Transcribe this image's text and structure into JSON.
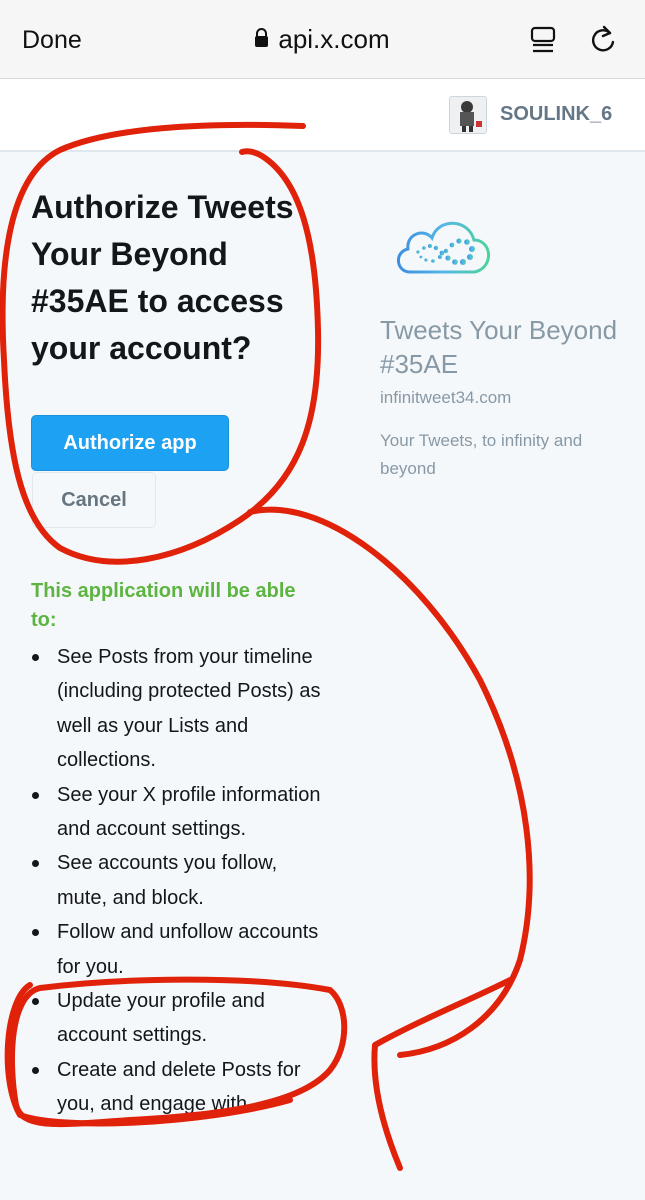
{
  "browser": {
    "done_label": "Done",
    "url": "api.x.com",
    "icons": [
      "lock-icon",
      "reader-icon",
      "reload-icon"
    ]
  },
  "account": {
    "username": "SOULINK_6"
  },
  "auth": {
    "title": "Authorize Tweets Your Beyond #35AE to access your account?",
    "authorize_label": "Authorize app",
    "cancel_label": "Cancel"
  },
  "permissions": {
    "heading": "This application will be able to:",
    "items": [
      "See Posts from your timeline (including protected Posts) as well as your Lists and collections.",
      "See your X profile information and account settings.",
      "See accounts you follow, mute, and block.",
      "Follow and unfollow accounts for you.",
      "Update your profile and account settings.",
      "Create and delete Posts for you, and engage with"
    ]
  },
  "app": {
    "name": "Tweets Your Beyond #35AE",
    "domain": "infinitweet34.com",
    "description": "Your Tweets, to infinity and beyond"
  },
  "colors": {
    "primary_button": "#1da1f2",
    "permission_heading": "#5db441",
    "annotation": "#e0220a",
    "muted_text": "#8899a6"
  }
}
